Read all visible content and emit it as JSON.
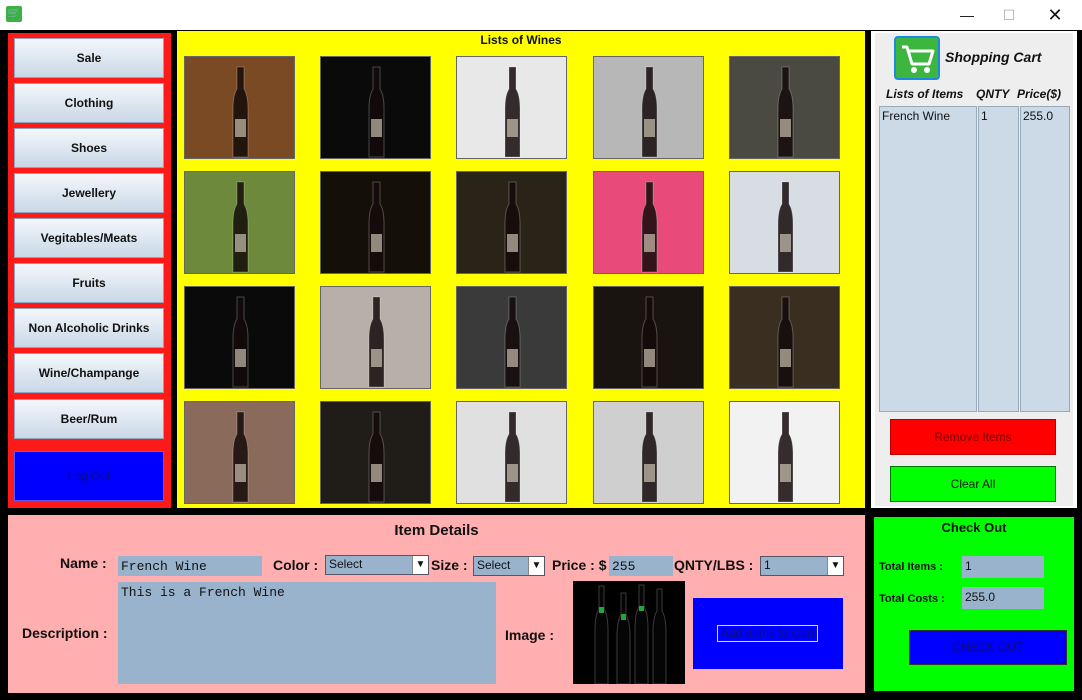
{
  "window": {
    "icon": "app-cart-icon",
    "minimize": "—",
    "maximize": "☐",
    "close": "✕"
  },
  "categories": [
    "Sale",
    "Clothing",
    "Shoes",
    "Jewellery",
    "Vegitables/Meats",
    "Fruits",
    "Non Alcoholic Drinks",
    "Wine/Champange",
    "Beer/Rum"
  ],
  "logout_label": "Log Out",
  "wines": {
    "title": "Lists of Wines",
    "tiles": [
      {
        "bg": "#7a4a25"
      },
      {
        "bg": "#0a0a0a"
      },
      {
        "bg": "#e8e8e8"
      },
      {
        "bg": "#b7b7b7"
      },
      {
        "bg": "#4a4a42"
      },
      {
        "bg": "#6d8a3c"
      },
      {
        "bg": "#141008"
      },
      {
        "bg": "#2a2418"
      },
      {
        "bg": "#e84a7a"
      },
      {
        "bg": "#d8dde4"
      },
      {
        "bg": "#0a0a0a"
      },
      {
        "bg": "#b8b0a8"
      },
      {
        "bg": "#3a3a3a"
      },
      {
        "bg": "#1a1410"
      },
      {
        "bg": "#3a2e20"
      },
      {
        "bg": "#8a6a5a"
      },
      {
        "bg": "#201c18"
      },
      {
        "bg": "#e0e0e0"
      },
      {
        "bg": "#cfcfcf"
      },
      {
        "bg": "#f2f2f2"
      }
    ]
  },
  "cart": {
    "title": "Shopping Cart",
    "col_items": "Lists of Items",
    "col_qnty": "QNTY",
    "col_price": "Price($)",
    "item": "French Wine",
    "qnty": "1",
    "price": "255.0",
    "remove_label": "Remove Items",
    "clear_label": "Clear All"
  },
  "details": {
    "title": "Item Details",
    "name_label": "Name :",
    "name_value": "French Wine",
    "color_label": "Color :",
    "color_value": "Select",
    "size_label": "Size :",
    "size_value": "Select",
    "price_label": "Price : $",
    "price_value": "255",
    "qnty_label": "QNTY/LBS :",
    "qnty_value": "1",
    "description_label": "Description :",
    "description_value": "This is a French Wine",
    "image_label": "Image :",
    "add_label": "Add Items to Cart"
  },
  "checkout": {
    "title": "Check Out",
    "total_items_label": "Total Items :",
    "total_items_value": "1",
    "total_costs_label": "Total Costs :",
    "total_costs_value": "255.0",
    "button_label": "CHECK OUT"
  }
}
